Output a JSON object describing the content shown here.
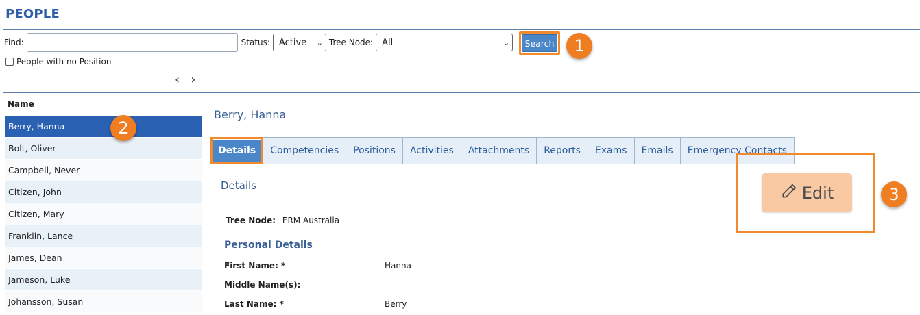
{
  "page": {
    "title": "PEOPLE"
  },
  "filters": {
    "find_label": "Find:",
    "find_value": "",
    "status_label": "Status:",
    "status_value": "Active",
    "tree_node_label": "Tree Node:",
    "tree_node_value": "All",
    "search_label": "Search",
    "no_position_label": "People with no Position",
    "no_position_checked": false
  },
  "pager": {
    "prev": "‹",
    "next": "›"
  },
  "list": {
    "header": "Name",
    "selected_index": 0,
    "people": [
      "Berry, Hanna",
      "Bolt, Oliver",
      "Campbell, Never",
      "Citizen, John",
      "Citizen, Mary",
      "Franklin, Lance",
      "James, Dean",
      "Jameson, Luke",
      "Johansson, Susan"
    ]
  },
  "detail": {
    "person_name": "Berry, Hanna",
    "tabs": [
      "Details",
      "Competencies",
      "Positions",
      "Activities",
      "Attachments",
      "Reports",
      "Exams",
      "Emails",
      "Emergency Contacts"
    ],
    "active_tab": "Details",
    "section_title": "Details",
    "tree_node_label": "Tree Node:",
    "tree_node_value": "ERM Australia",
    "personal_details_title": "Personal Details",
    "first_name_label": "First Name: *",
    "first_name_value": "Hanna",
    "middle_name_label": "Middle Name(s):",
    "middle_name_value": "",
    "last_name_label": "Last Name: *",
    "last_name_value": "Berry",
    "edit_label": "Edit"
  },
  "callouts": [
    "1",
    "2",
    "3"
  ],
  "colors": {
    "accent_blue": "#2b61b3",
    "button_blue": "#4a86c8",
    "highlight_orange": "#f08a2c",
    "badge_orange": "#ef7d22",
    "edit_bg": "#f9c9a4"
  },
  "icons": {
    "edit": "pencil-icon",
    "select": "chevron-down-icon"
  }
}
